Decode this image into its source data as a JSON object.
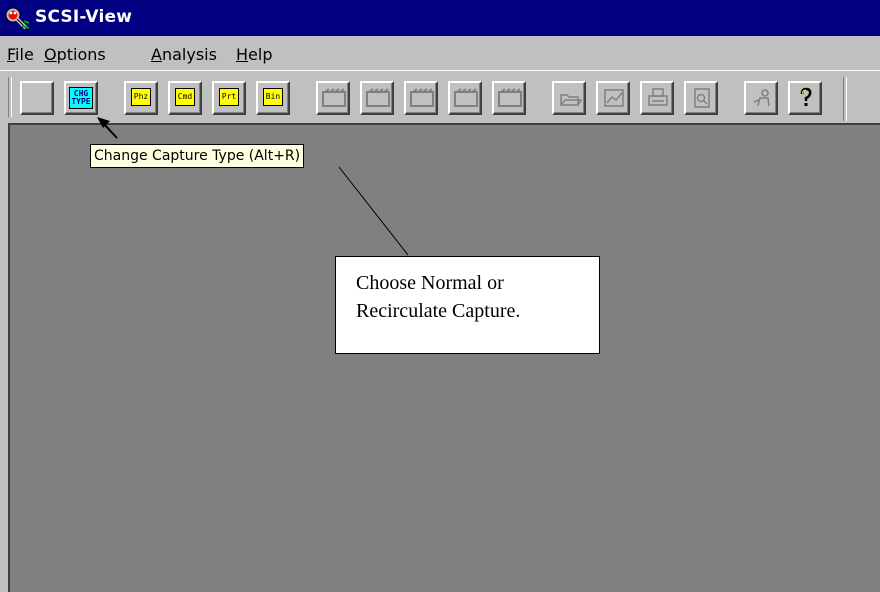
{
  "window": {
    "title": "SCSI-View",
    "app_icon": "magnifier-bug-icon"
  },
  "menu": {
    "items": [
      {
        "mnemonic": "F",
        "rest": "ile"
      },
      {
        "mnemonic": "O",
        "rest": "ptions"
      },
      {
        "mnemonic": "A",
        "rest": "nalysis"
      },
      {
        "mnemonic": "H",
        "rest": "elp"
      }
    ]
  },
  "toolbar": {
    "buttons": [
      {
        "icon": "blank-icon",
        "label": ""
      },
      {
        "icon": "change-capture-type-icon",
        "label": "CHG\nTYPE"
      },
      {
        "icon": "phases-icon",
        "label": "Phz"
      },
      {
        "icon": "commands-icon",
        "label": "Cmd"
      },
      {
        "icon": "protocol-icon",
        "label": "Prt"
      },
      {
        "icon": "binary-data-icon",
        "label": "Bin"
      },
      {
        "icon": "film-icon-1",
        "label": ""
      },
      {
        "icon": "film-icon-2",
        "label": ""
      },
      {
        "icon": "film-icon-3",
        "label": ""
      },
      {
        "icon": "film-icon-4",
        "label": ""
      },
      {
        "icon": "film-icon-5",
        "label": ""
      },
      {
        "icon": "open-file-icon",
        "label": ""
      },
      {
        "icon": "chart-icon",
        "label": ""
      },
      {
        "icon": "print-icon",
        "label": ""
      },
      {
        "icon": "print-preview-icon",
        "label": ""
      },
      {
        "icon": "about-icon",
        "label": ""
      },
      {
        "icon": "help-icon",
        "label": ""
      }
    ]
  },
  "tooltip": {
    "text": "Change Capture Type (Alt+R)"
  },
  "callout": {
    "line1": "Choose Normal or",
    "line2": "Recirculate Capture."
  },
  "colors": {
    "titlebar": "#000080",
    "face": "#c0c0c0",
    "workspace": "#808080",
    "tooltip_bg": "#ffffe1",
    "button_yellow": "#ffff00",
    "button_cyan": "#00ffff"
  }
}
